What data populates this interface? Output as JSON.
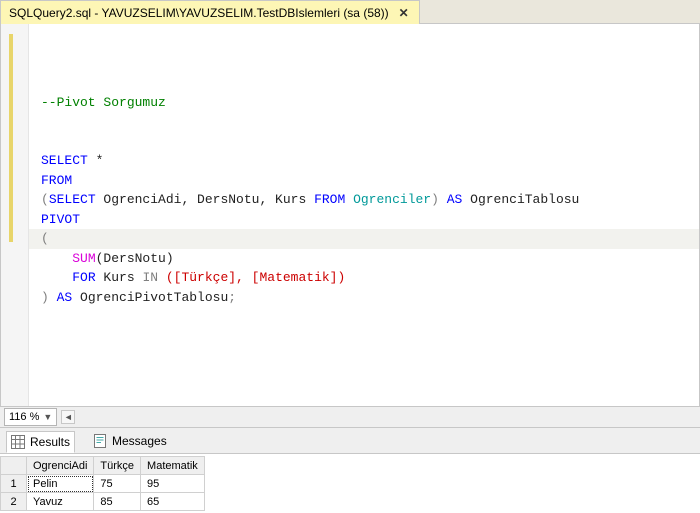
{
  "tab": {
    "title": "SQLQuery2.sql - YAVUZSELIM\\YAVUZSELIM.TestDBIslemleri (sa (58))",
    "close": "✕"
  },
  "code": {
    "comment": "--Pivot Sorgumuz",
    "select": "SELECT",
    "star": " *",
    "from": "FROM",
    "open": "(",
    "inner_select": "SELECT",
    "inner_cols": " OgrenciAdi, DersNotu, Kurs ",
    "inner_from": "FROM",
    "inner_table": " Ogrenciler",
    "close1": ")",
    "as1": " AS ",
    "alias1": "OgrenciTablosu",
    "pivot": "PIVOT",
    "open2": "(",
    "indent": "    ",
    "sum": "SUM",
    "sumargs": "(DersNotu)",
    "for": "FOR",
    "forcol": " Kurs ",
    "in": "IN",
    "inargs": " ([Türkçe], [Matematik])",
    "close2": ")",
    "as2": " AS ",
    "alias2": "OgrenciPivotTablosu",
    "semi": ";"
  },
  "zoom": {
    "value": "116 %"
  },
  "results_tabs": {
    "results": "Results",
    "messages": "Messages"
  },
  "grid": {
    "columns": [
      "OgrenciAdi",
      "Türkçe",
      "Matematik"
    ],
    "rows": [
      {
        "n": "1",
        "c0": "Pelin",
        "c1": "75",
        "c2": "95"
      },
      {
        "n": "2",
        "c0": "Yavuz",
        "c1": "85",
        "c2": "65"
      }
    ]
  }
}
